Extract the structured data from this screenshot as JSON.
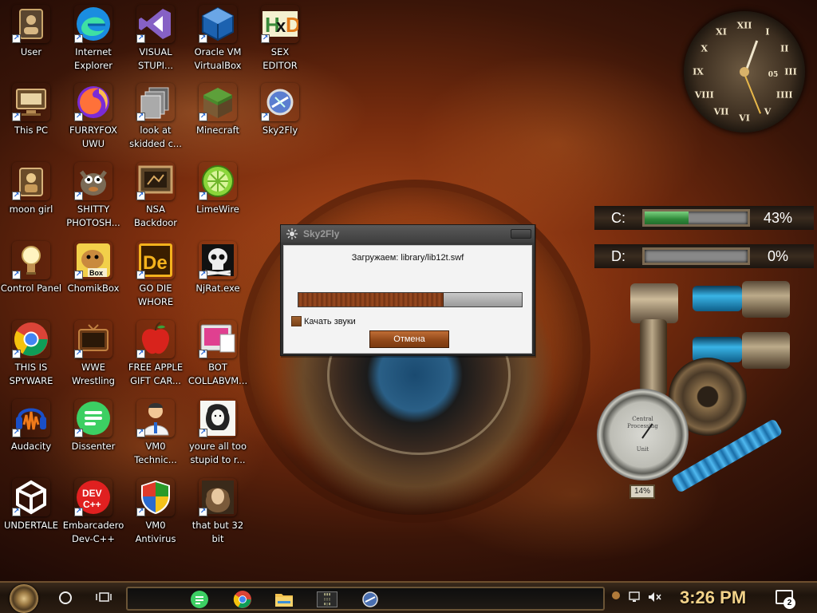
{
  "desktop": {
    "icons": [
      {
        "label": "User",
        "icon": "user-folder-icon"
      },
      {
        "label": "Internet\nExplorer",
        "icon": "edge-icon"
      },
      {
        "label": "VISUAL\nSTUPI...",
        "icon": "visual-studio-icon"
      },
      {
        "label": "Oracle VM\nVirtualBox",
        "icon": "virtualbox-icon"
      },
      {
        "label": "SEX\nEDITOR",
        "icon": "hxd-editor-icon"
      },
      {
        "label": "This PC",
        "icon": "this-pc-icon"
      },
      {
        "label": "FURRYFOX\nUWU",
        "icon": "firefox-icon"
      },
      {
        "label": "look at\nskidded c...",
        "icon": "files-stack-icon"
      },
      {
        "label": "Minecraft",
        "icon": "minecraft-icon"
      },
      {
        "label": "Sky2Fly",
        "icon": "sky2fly-icon"
      },
      {
        "label": "moon girl",
        "icon": "moon-girl-icon"
      },
      {
        "label": "SHITTY\nPHOTOSH...",
        "icon": "gimp-icon"
      },
      {
        "label": "NSA\nBackdoor",
        "icon": "nsa-backdoor-icon"
      },
      {
        "label": "LimeWire",
        "icon": "limewire-icon"
      },
      {
        "label": "Control Panel",
        "icon": "control-panel-icon"
      },
      {
        "label": "ChomikBox",
        "icon": "chomikbox-icon"
      },
      {
        "label": "GO DIE\nWHORE",
        "icon": "godie-de-icon"
      },
      {
        "label": "NjRat.exe",
        "icon": "skull-icon"
      },
      {
        "label": "THIS IS\nSPYWARE",
        "icon": "chrome-icon"
      },
      {
        "label": "WWE\nWrestling",
        "icon": "tv-icon"
      },
      {
        "label": "FREE APPLE\nGIFT CAR...",
        "icon": "apple-icon"
      },
      {
        "label": "BOT\nCOLLABVM...",
        "icon": "bot-collabvm-icon"
      },
      {
        "label": "Audacity",
        "icon": "audacity-icon"
      },
      {
        "label": "Dissenter",
        "icon": "dissenter-icon"
      },
      {
        "label": "VM0\nTechnic...",
        "icon": "technician-icon"
      },
      {
        "label": "youre all too\nstupid to r...",
        "icon": "portrait-sketch-icon"
      },
      {
        "label": "UNDERTALE",
        "icon": "unity-icon"
      },
      {
        "label": "Embarcadero\nDev-C++",
        "icon": "devcpp-icon"
      },
      {
        "label": "VM0\nAntivirus",
        "icon": "shield-icon"
      },
      {
        "label": "that but 32\nbit",
        "icon": "portrait-painting-icon"
      }
    ]
  },
  "clock": {
    "numerals": [
      "XII",
      "I",
      "II",
      "III",
      "IIII",
      "V",
      "VI",
      "VII",
      "VIII",
      "IX",
      "X",
      "XI"
    ],
    "sub_dial": "05"
  },
  "drives": [
    {
      "letter": "C:",
      "percent_label": "43%",
      "fill": 0.43
    },
    {
      "letter": "D:",
      "percent_label": "0%",
      "fill": 0.0
    }
  ],
  "gauge": {
    "top_text": "Central",
    "mid_text": "Processing",
    "unit_text": "Unit",
    "reading": "14%"
  },
  "dialog": {
    "title": "Sky2Fly",
    "loading_text": "Загружаем: library/lib12t.swf",
    "progress": 0.65,
    "checkbox_label": "Качать звуки",
    "checkbox_checked": true,
    "cancel_label": "Отмена"
  },
  "taskbar": {
    "pinned": [
      "dissenter-icon",
      "chrome-icon",
      "file-explorer-icon",
      "winamp-icon",
      "sky2fly-icon"
    ],
    "clock_time": "3:26 PM",
    "notification_count": "2"
  },
  "colors": {
    "accent_brown": "#8e4618",
    "time_gold": "#f2d289",
    "drive_green": "#2f8a3a"
  }
}
